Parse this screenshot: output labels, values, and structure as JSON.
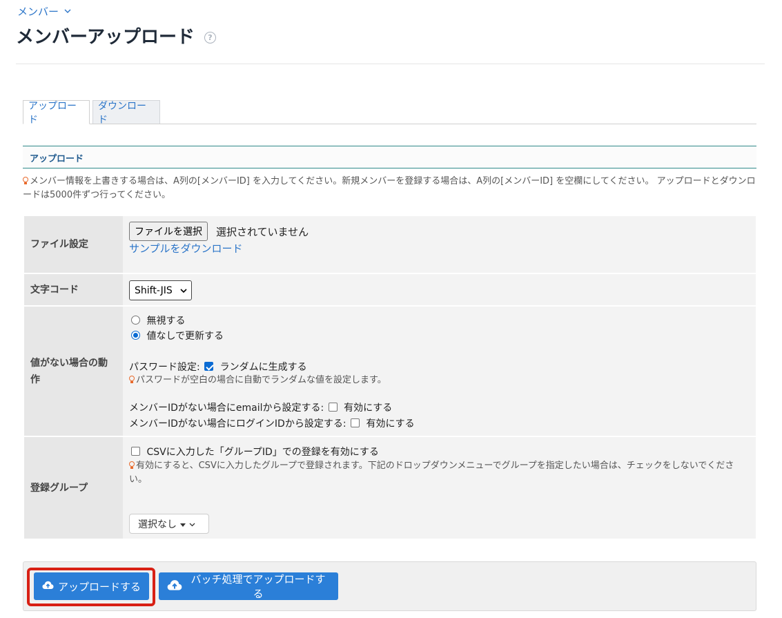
{
  "breadcrumb": {
    "label": "メンバー"
  },
  "page": {
    "title": "メンバーアップロード",
    "help_glyph": "?"
  },
  "tabs": [
    {
      "label": "アップロード",
      "active": true
    },
    {
      "label": "ダウンロード",
      "active": false
    }
  ],
  "section": {
    "title": "アップロード"
  },
  "info_note": "メンバー情報を上書きする場合は、A列の[メンバーID] を入力してください。新規メンバーを登録する場合は、A列の[メンバーID] を空欄にしてください。 アップロードとダウンロードは5000件ずつ行ってください。",
  "form": {
    "file_setting": {
      "label": "ファイル設定",
      "choose_button": "ファイルを選択",
      "status": "選択されていません",
      "sample_link": "サンプルをダウンロード"
    },
    "encoding": {
      "label": "文字コード",
      "selected": "Shift-JIS"
    },
    "empty_value": {
      "label_line1": "値がない場合の動",
      "label_line2": "作",
      "options": [
        {
          "label": "無視する",
          "checked": false
        },
        {
          "label": "値なしで更新する",
          "checked": true
        }
      ],
      "password_label": "パスワード設定:",
      "password_option": "ランダムに生成する",
      "password_checked": true,
      "password_hint": "パスワードが空白の場合に自動でランダムな値を設定します。",
      "email_label": "メンバーIDがない場合にemailから設定する:",
      "email_option": "有効にする",
      "login_label": "メンバーIDがない場合にログインIDから設定する:",
      "login_option": "有効にする"
    },
    "group": {
      "label": "登録グループ",
      "csv_option": "CSVに入力した「グループID」での登録を有効にする",
      "hint": "有効にすると、CSVに入力したグループで登録されます。下記のドロップダウンメニューでグループを指定したい場合は、チェックをしないでください。",
      "dropdown": "選択なし"
    }
  },
  "actions": {
    "upload": "アップロードする",
    "batch_upload": "バッチ処理でアップロードする"
  },
  "colors": {
    "accent": "#2b7fd8",
    "highlight": "#d82014",
    "link": "#2a74c8"
  }
}
